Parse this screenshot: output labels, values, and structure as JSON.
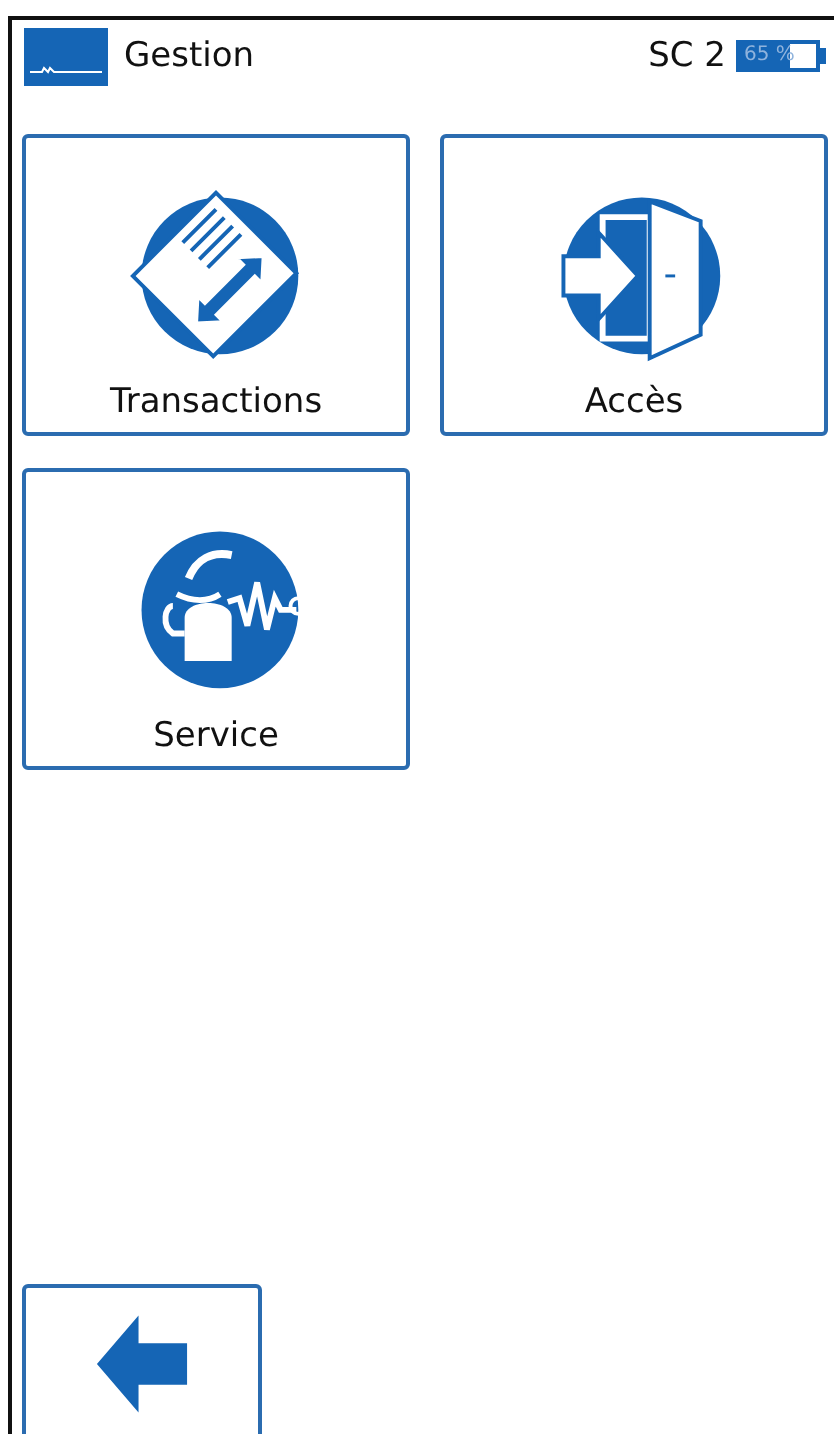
{
  "header": {
    "title": "Gestion",
    "station": "SC 2",
    "battery": {
      "label": "65 %",
      "level": 0.65
    }
  },
  "tiles": [
    {
      "label": "Transactions",
      "kind": "transactions"
    },
    {
      "label": "Accès",
      "kind": "access"
    },
    {
      "label": "Service",
      "kind": "service"
    }
  ]
}
